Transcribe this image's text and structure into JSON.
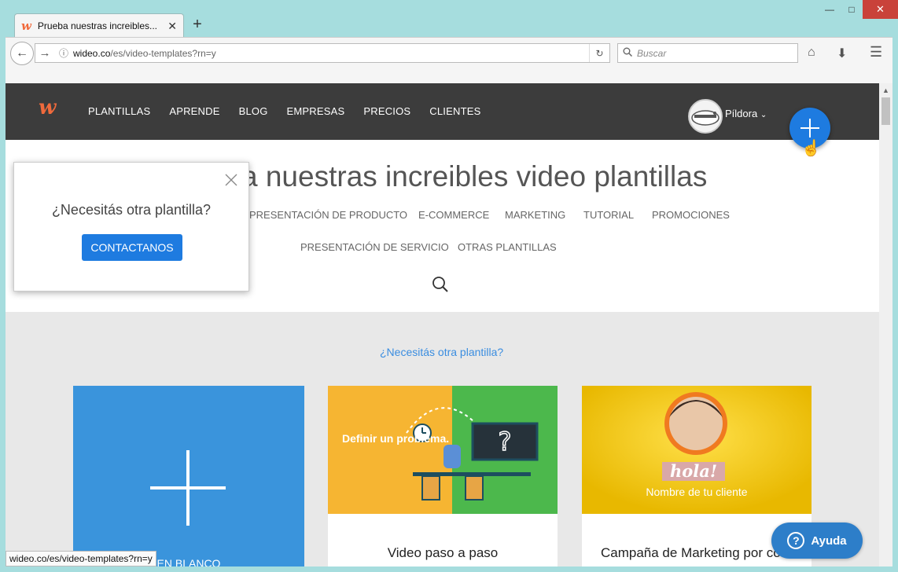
{
  "browser": {
    "tab_title": "Prueba nuestras increibles...",
    "tab_logo": "w",
    "url_domain": "wideo.co",
    "url_path": "/es/video-templates?rn=y",
    "search_placeholder": "Buscar",
    "status_url": "wideo.co/es/video-templates?rn=y"
  },
  "header": {
    "logo": "w",
    "nav": [
      "PLANTILLAS",
      "APRENDE",
      "BLOG",
      "EMPRESAS",
      "PRECIOS",
      "CLIENTES"
    ],
    "user_name": "Píldora"
  },
  "hero": {
    "title": "a nuestras increibles video plantillas",
    "categories_row1": [
      "PRESENTACIÓN DE PRODUCTO",
      "E-COMMERCE",
      "MARKETING",
      "TUTORIAL",
      "PROMOCIONES"
    ],
    "categories_row2": [
      "PRESENTACIÓN DE SERVICIO",
      "OTRAS PLANTILLAS"
    ]
  },
  "popup": {
    "question": "¿Necesitás otra plantilla?",
    "button": "CONTACTANOS"
  },
  "content": {
    "need_link": "¿Necesitás otra plantilla?",
    "cards": [
      {
        "caption": "EN BLANCO"
      },
      {
        "caption": "Video paso a paso",
        "art_text": "Definir un problema."
      },
      {
        "caption": "Campaña de Marketing por co",
        "art_hola": "hola!",
        "art_client": "Nombre de tu cliente"
      }
    ]
  },
  "help": {
    "label": "Ayuda"
  },
  "colors": {
    "brand": "#f06a3c",
    "primary": "#1e7be0",
    "header_bg": "#3c3c3c"
  }
}
